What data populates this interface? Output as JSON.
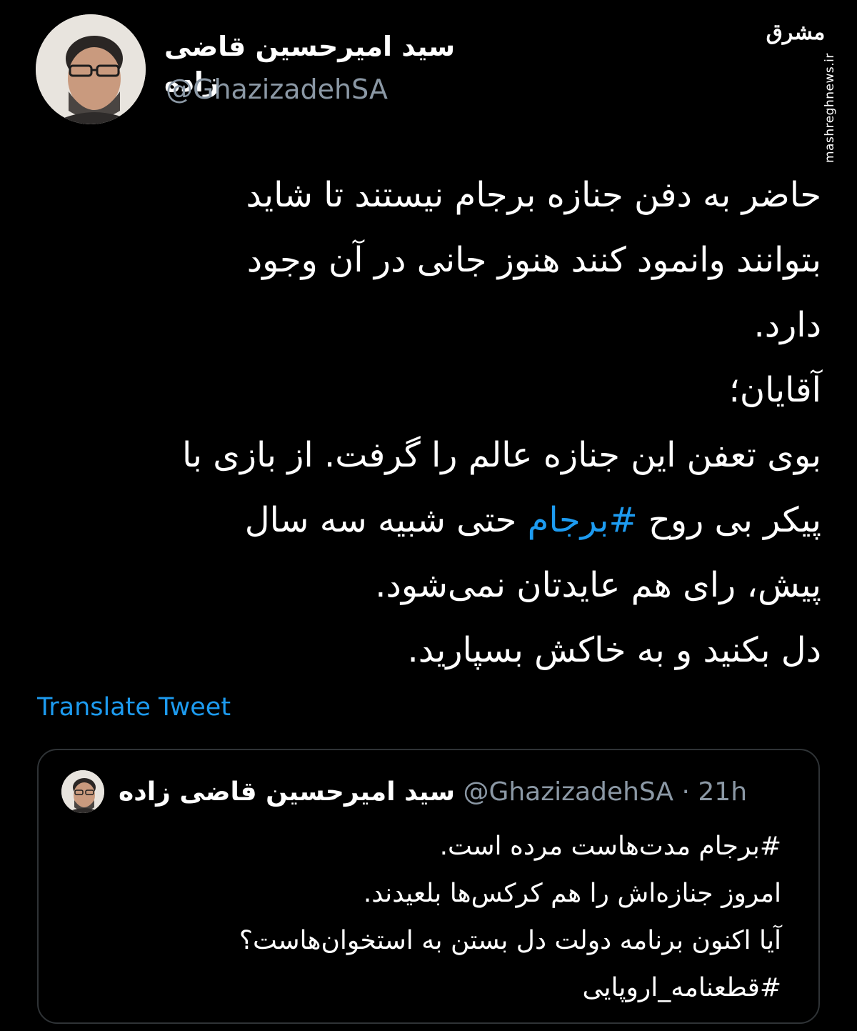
{
  "author": {
    "name": "سید امیرحسین قاضی زاده",
    "handle": "@GhazizadehSA",
    "avatar_icon": "profile-photo"
  },
  "watermark": {
    "logo": "مشرق",
    "url": "mashreghnews.ir"
  },
  "tweet": {
    "lines": [
      "حاضر به دفن جنازه برجام نیستند تا شاید",
      "بتوانند وانمود کنند هنوز جانی در آن وجود",
      "دارد.",
      "آقایان؛",
      "بوی تعفن این جنازه عالم را گرفت. از بازی با"
    ],
    "line6_before": "پیکر بی روح ",
    "line6_hashtag": "#برجام",
    "line6_after": " حتی شبیه سه سال",
    "lines_end": [
      "پیش، رای هم عایدتان نمی‌شود.",
      "دل بکنید و به خاکش بسپارید."
    ],
    "translate_label": "Translate Tweet"
  },
  "quoted_tweet": {
    "name": "سید امیرحسین قاضی زاده",
    "handle": "@GhazizadehSA",
    "separator": "·",
    "time": "21h",
    "lines": [
      "#برجام مدت‌هاست مرده است.",
      "امروز جنازه‌اش را هم کرکس‌ها بلعیدند.",
      "آیا اکنون برنامه دولت دل بستن به استخوان‌هاست؟",
      "#قطعنامه_اروپایی"
    ]
  },
  "colors": {
    "background": "#000000",
    "text": "#ffffff",
    "secondary": "#8b98a5",
    "link": "#1d9bf0",
    "border": "#2f3336"
  }
}
